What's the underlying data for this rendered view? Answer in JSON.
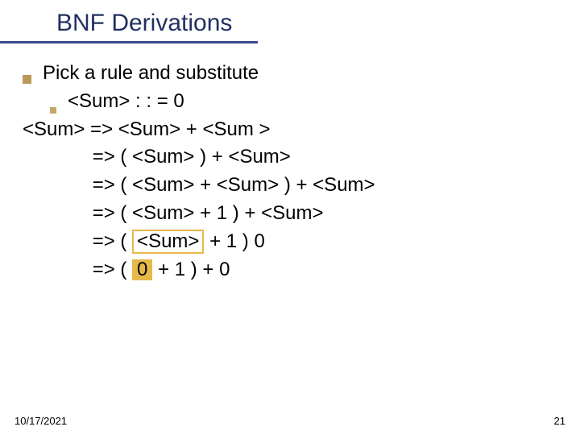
{
  "title": "BNF Derivations",
  "main_bullet": "Pick a rule and substitute",
  "sub_bullet": "<Sum> : : = 0",
  "deriv": {
    "lhs": "<Sum> ",
    "r1": "=> <Sum> + <Sum >",
    "r2": "=> ( <Sum> ) + <Sum>",
    "r3": "=> ( <Sum> + <Sum> ) + <Sum>",
    "r4": "=> ( <Sum> + 1 ) + <Sum>",
    "r5a": "=> ( ",
    "r5_hl": "<Sum>",
    "r5b": " + 1 ) 0",
    "r6a": "=> ( ",
    "r6_hl": "0",
    "r6b": " + 1 ) + 0"
  },
  "footer": {
    "date": "10/17/2021",
    "page": "21"
  }
}
